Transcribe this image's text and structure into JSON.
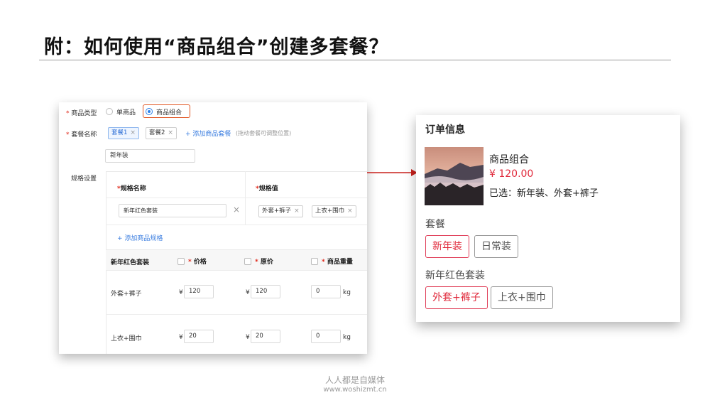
{
  "slide": {
    "title": "附：如何使用“商品组合”创建多套餐？"
  },
  "form": {
    "type_label": "商品类型",
    "type_options": [
      "单商品",
      "商品组合"
    ],
    "type_selected": "商品组合",
    "package_label": "套餐名称",
    "package_tags": [
      "套餐1",
      "套餐2"
    ],
    "add_package_link": "+ 添加商品套餐",
    "add_package_hint": "(拖动套餐可调整位置)",
    "package_name_value": "新年装",
    "spec_label": "规格设置",
    "spec_name_header": "规格名称",
    "spec_value_header": "规格值",
    "spec_name_value": "新年红色套装",
    "spec_values": [
      "外套+裤子",
      "上衣+围巾"
    ],
    "add_spec_link": "+ 添加商品规格",
    "table": {
      "col_spec": "新年红色套装",
      "col_price": "价格",
      "col_orig": "原价",
      "col_weight": "商品重量",
      "currency": "¥",
      "weight_unit": "kg",
      "rows": [
        {
          "name": "外套+裤子",
          "price": "120",
          "orig": "120",
          "weight": "0"
        },
        {
          "name": "上衣+围巾",
          "price": "20",
          "orig": "20",
          "weight": "0"
        }
      ]
    },
    "close_glyph": "×"
  },
  "order": {
    "title": "订单信息",
    "product_name": "商品组合",
    "price": "¥ 120.00",
    "selected_text": "已选：新年装、外套+裤子",
    "package_section": "套餐",
    "package_options": [
      "新年装",
      "日常装"
    ],
    "package_selected": "新年装",
    "spec_section": "新年红色套装",
    "spec_options": [
      "外套+裤子",
      "上衣+围巾"
    ],
    "spec_selected": "外套+裤子",
    "accent_color": "#e0283a"
  },
  "footer": {
    "line1": "人人都是自媒体",
    "line2": "www.woshizmt.cn"
  }
}
